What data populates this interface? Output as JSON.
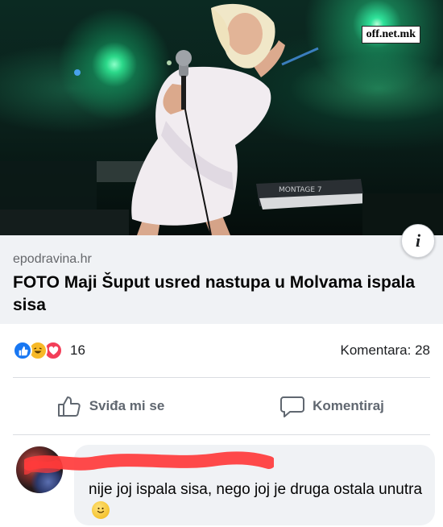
{
  "photo": {
    "watermark": "off.net.mk",
    "keyboard_label": "MONTAGE 7"
  },
  "link": {
    "domain": "epodravina.hr",
    "title": "FOTO Maji Šuput usred nastupa u Molvama ispala sisa"
  },
  "reactions": {
    "count": "16",
    "icons": [
      "like-icon",
      "haha-icon",
      "love-icon"
    ],
    "comments_label": "Komentara: 28"
  },
  "actions": {
    "like_label": "Sviđa mi se",
    "comment_label": "Komentiraj"
  },
  "comment": {
    "text": "nije joj ispala sisa, nego joj je druga ostala unutra",
    "emoji": "slightly-smiling-face-icon"
  },
  "colors": {
    "like_blue": "#1877f2",
    "haha_yellow": "#f7b928",
    "love_red": "#f33e58",
    "scribble_red": "#ff3b3b",
    "link_bg": "#f0f2f5"
  }
}
